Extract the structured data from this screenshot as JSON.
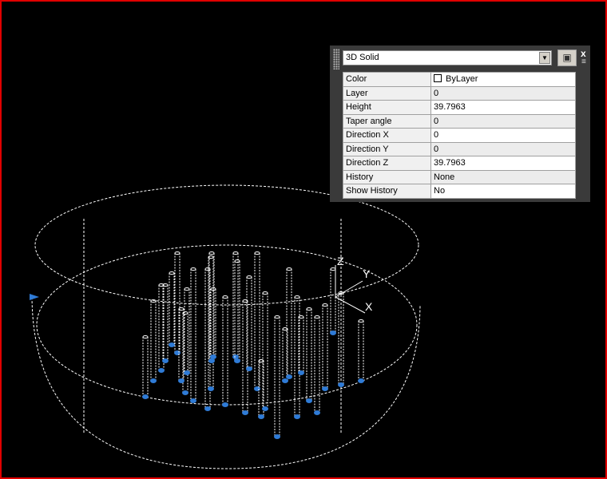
{
  "properties": {
    "object_type": "3D Solid",
    "rows": [
      {
        "label": "Color",
        "value": "ByLayer"
      },
      {
        "label": "Layer",
        "value": "0"
      },
      {
        "label": "Height",
        "value": "39.7963"
      },
      {
        "label": "Taper angle",
        "value": "0"
      },
      {
        "label": "Direction X",
        "value": "0"
      },
      {
        "label": "Direction Y",
        "value": "0"
      },
      {
        "label": "Direction Z",
        "value": "39.7963"
      },
      {
        "label": "History",
        "value": "None"
      },
      {
        "label": "Show History",
        "value": "No"
      }
    ],
    "close_glyph": "x"
  },
  "ucs": {
    "z": "Z",
    "y": "Y",
    "x": "X"
  },
  "colors": {
    "grip": "#2f7bd6",
    "frame": "#e00000",
    "lines": "#ffffff"
  }
}
